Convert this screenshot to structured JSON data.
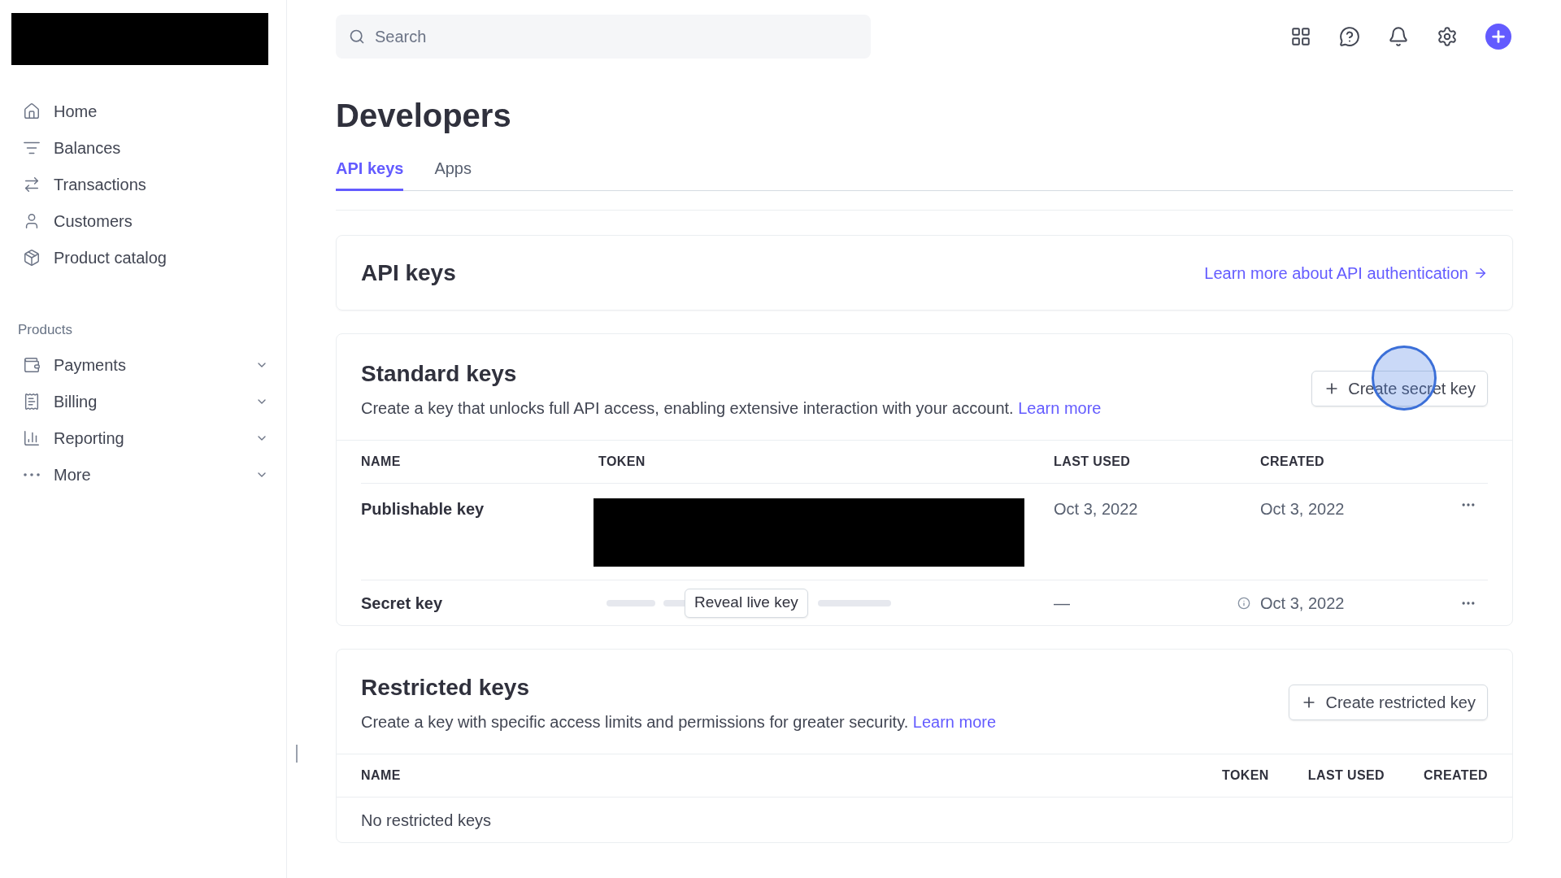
{
  "sidebar": {
    "nav": [
      {
        "label": "Home"
      },
      {
        "label": "Balances"
      },
      {
        "label": "Transactions"
      },
      {
        "label": "Customers"
      },
      {
        "label": "Product catalog"
      }
    ],
    "section_label": "Products",
    "products": [
      {
        "label": "Payments",
        "expanded": false
      },
      {
        "label": "Billing",
        "expanded": false
      },
      {
        "label": "Reporting",
        "expanded": false
      },
      {
        "label": "More",
        "expanded": false
      }
    ]
  },
  "search": {
    "placeholder": "Search"
  },
  "page_title": "Developers",
  "tabs": [
    {
      "label": "API keys",
      "selected": true
    },
    {
      "label": "Apps",
      "selected": false
    }
  ],
  "api_keys_card": {
    "title": "API keys",
    "link": "Learn more about API authentication"
  },
  "standard_keys": {
    "title": "Standard keys",
    "description": "Create a key that unlocks full API access, enabling extensive interaction with your account.",
    "link": "Learn more",
    "button": "Create secret key",
    "columns": [
      "NAME",
      "TOKEN",
      "LAST USED",
      "CREATED"
    ],
    "rows": [
      {
        "kind": "redacted",
        "name": "Publishable key",
        "last_used": "Oct 3, 2022",
        "created": "Oct 3, 2022"
      },
      {
        "kind": "hidden",
        "name": "Secret key",
        "reveal": "Reveal live key",
        "last_used": "—",
        "created": "Oct 3, 2022"
      }
    ]
  },
  "restricted_keys": {
    "title": "Restricted keys",
    "description": "Create a key with specific access limits and permissions for greater security.",
    "link": "Learn more",
    "button": "Create restricted key",
    "columns": [
      "NAME",
      "TOKEN",
      "LAST USED",
      "CREATED"
    ],
    "empty": "No restricted keys"
  }
}
